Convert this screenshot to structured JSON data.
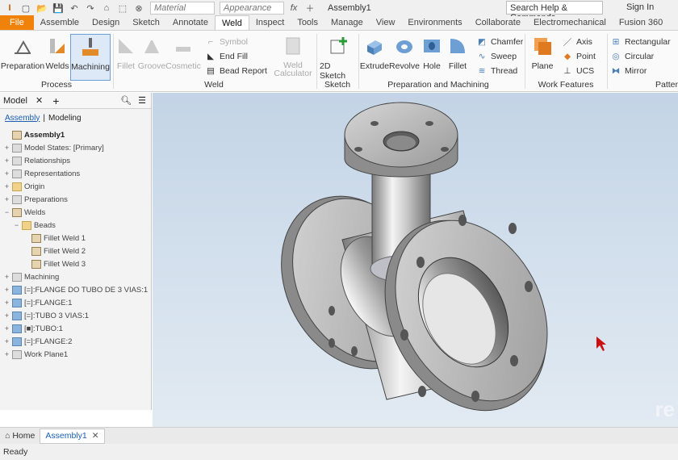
{
  "qat": {
    "material_placeholder": "Material",
    "appearance_placeholder": "Appearance",
    "doc_title": "Assembly1",
    "help_search": "Search Help & Commands...",
    "sign_in": "Sign In"
  },
  "tabs": [
    "File",
    "Assemble",
    "Design",
    "Sketch",
    "Annotate",
    "Weld",
    "Inspect",
    "Tools",
    "Manage",
    "View",
    "Environments",
    "Collaborate",
    "Electromechanical",
    "Fusion 360"
  ],
  "active_tab": "Weld",
  "ribbon": {
    "process": {
      "preparation": "Preparation",
      "welds": "Welds",
      "machining": "Machining",
      "label": "Process"
    },
    "weld": {
      "fillet": "Fillet",
      "groove": "Groove",
      "cosmetic": "Cosmetic",
      "symbol": "Symbol",
      "end_fill": "End Fill",
      "bead_report": "Bead Report",
      "weld_calc_1": "Weld",
      "weld_calc_2": "Calculator",
      "label": "Weld"
    },
    "sketch": {
      "sketch_2d": "2D Sketch",
      "label": "Sketch"
    },
    "prep_machining": {
      "extrude": "Extrude",
      "revolve": "Revolve",
      "hole": "Hole",
      "fillet": "Fillet",
      "chamfer": "Chamfer",
      "sweep": "Sweep",
      "thread": "Thread",
      "label": "Preparation and Machining"
    },
    "work_features": {
      "plane": "Plane",
      "axis": "Axis",
      "point": "Point",
      "ucs": "UCS",
      "label": "Work Features"
    },
    "pattern": {
      "rectangular": "Rectangular",
      "circular": "Circular",
      "mirror": "Mirror",
      "label": "Patter"
    }
  },
  "browser": {
    "tab_label": "Model",
    "view_assembly": "Assembly",
    "view_modeling": "Modeling",
    "tree": [
      {
        "label": "Assembly1",
        "level": 0,
        "exp": "",
        "icon": "asm",
        "bold": true
      },
      {
        "label": "Model States: [Primary]",
        "level": 0,
        "exp": "+",
        "icon": "gray"
      },
      {
        "label": "Relationships",
        "level": 0,
        "exp": "+",
        "icon": "gray"
      },
      {
        "label": "Representations",
        "level": 0,
        "exp": "+",
        "icon": "gray"
      },
      {
        "label": "Origin",
        "level": 0,
        "exp": "+",
        "icon": "fold"
      },
      {
        "label": "Preparations",
        "level": 0,
        "exp": "+",
        "icon": "gray"
      },
      {
        "label": "Welds",
        "level": 0,
        "exp": "−",
        "icon": "weld"
      },
      {
        "label": "Beads",
        "level": 1,
        "exp": "−",
        "icon": "fold"
      },
      {
        "label": "Fillet Weld 1",
        "level": 2,
        "exp": "",
        "icon": "weld"
      },
      {
        "label": "Fillet Weld 2",
        "level": 2,
        "exp": "",
        "icon": "weld"
      },
      {
        "label": "Fillet Weld 3",
        "level": 2,
        "exp": "",
        "icon": "weld"
      },
      {
        "label": "Machining",
        "level": 0,
        "exp": "+",
        "icon": "gray"
      },
      {
        "label": "[=]:FLANGE DO TUBO DE 3 VIAS:1",
        "level": 0,
        "exp": "+",
        "icon": "blue"
      },
      {
        "label": "[=]:FLANGE:1",
        "level": 0,
        "exp": "+",
        "icon": "blue"
      },
      {
        "label": "[=]:TUBO 3 VIAS:1",
        "level": 0,
        "exp": "+",
        "icon": "blue"
      },
      {
        "label": "[■]:TUBO:1",
        "level": 0,
        "exp": "+",
        "icon": "blue"
      },
      {
        "label": "[=]:FLANGE:2",
        "level": 0,
        "exp": "+",
        "icon": "blue"
      },
      {
        "label": "Work Plane1",
        "level": 0,
        "exp": "+",
        "icon": "gray"
      }
    ]
  },
  "doc_tabs": {
    "home": "Home",
    "assembly": "Assembly1"
  },
  "status": "Ready",
  "watermark": "re",
  "colors": {
    "file_tab": "#f0820a",
    "accent": "#1a5fb4",
    "cursor": "#cc1010"
  }
}
